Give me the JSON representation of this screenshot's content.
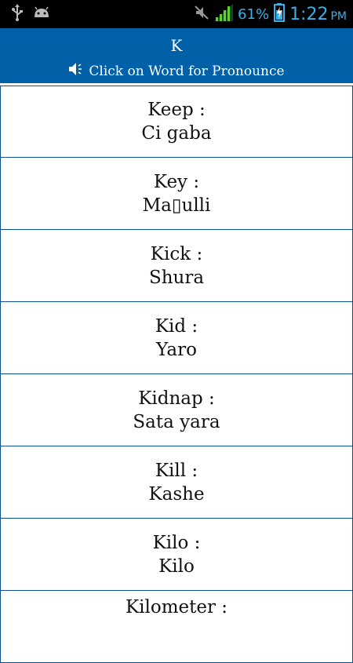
{
  "status_bar": {
    "icons_left": [
      "usb-icon",
      "android-icon"
    ],
    "icons_right": [
      "mute-icon",
      "signal-icon",
      "battery-charging-icon"
    ],
    "battery_percent": "61%",
    "time": "1:22",
    "ampm": "PM",
    "accent_color": "#3ab0e8"
  },
  "header": {
    "title": "K",
    "subtitle": "Click on Word for Pronounce",
    "speaker_icon": "speaker-icon",
    "background": "#0060a8"
  },
  "words": [
    {
      "english": "Keep :",
      "translation": "Ci gaba"
    },
    {
      "english": "Key :",
      "translation": "Ma▯ulli"
    },
    {
      "english": "Kick :",
      "translation": "Shura"
    },
    {
      "english": "Kid :",
      "translation": "Yaro"
    },
    {
      "english": "Kidnap :",
      "translation": "Sata yara"
    },
    {
      "english": "Kill :",
      "translation": "Kashe"
    },
    {
      "english": "Kilo :",
      "translation": "Kilo"
    },
    {
      "english": "Kilometer :",
      "translation": ""
    }
  ]
}
